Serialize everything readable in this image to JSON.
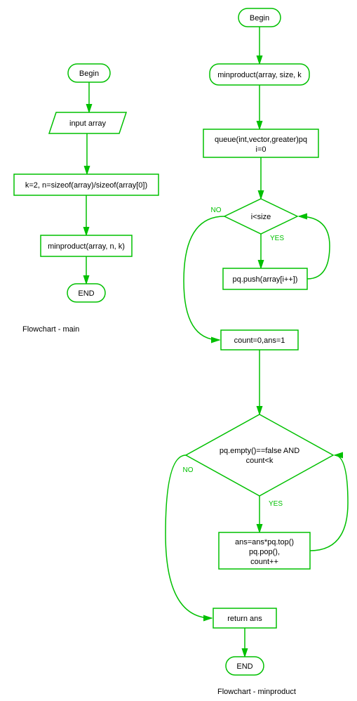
{
  "main": {
    "begin": "Begin",
    "input": "input array",
    "assign": "k=2, n=sizeof(array)/sizeof(array[0])",
    "call": "minproduct(array, n, k)",
    "end": "END",
    "caption": "Flowchart - main"
  },
  "minproduct": {
    "begin": "Begin",
    "call": "minproduct(array, size, k",
    "queue_line1": "queue(int,vector,greater)pq",
    "queue_line2": "i=0",
    "cond1": "i<size",
    "cond1_no": "NO",
    "cond1_yes": "YES",
    "push": "pq.push(array[i++])",
    "assign2": "count=0,ans=1",
    "cond2_line1": "pq.empty()==false AND",
    "cond2_line2": "count<k",
    "cond2_no": "NO",
    "cond2_yes": "YES",
    "body_line1": "ans=ans*pq.top()",
    "body_line2": "pq.pop(),",
    "body_line3": "count++",
    "return": "return ans",
    "end": "END",
    "caption": "Flowchart - minproduct"
  },
  "chart_data": [
    {
      "type": "flowchart",
      "name": "main",
      "nodes": [
        {
          "id": "m1",
          "shape": "terminator",
          "label": "Begin"
        },
        {
          "id": "m2",
          "shape": "parallelogram",
          "label": "input array"
        },
        {
          "id": "m3",
          "shape": "rectangle",
          "label": "k=2, n=sizeof(array)/sizeof(array[0])"
        },
        {
          "id": "m4",
          "shape": "rectangle",
          "label": "minproduct(array, n, k)"
        },
        {
          "id": "m5",
          "shape": "terminator",
          "label": "END"
        }
      ],
      "edges": [
        {
          "from": "m1",
          "to": "m2"
        },
        {
          "from": "m2",
          "to": "m3"
        },
        {
          "from": "m3",
          "to": "m4"
        },
        {
          "from": "m4",
          "to": "m5"
        }
      ]
    },
    {
      "type": "flowchart",
      "name": "minproduct",
      "nodes": [
        {
          "id": "p1",
          "shape": "terminator",
          "label": "Begin"
        },
        {
          "id": "p2",
          "shape": "rectangle",
          "label": "minproduct(array, size, k"
        },
        {
          "id": "p3",
          "shape": "rectangle",
          "label": "queue(int,vector,greater)pq\ni=0"
        },
        {
          "id": "p4",
          "shape": "diamond",
          "label": "i<size"
        },
        {
          "id": "p5",
          "shape": "rectangle",
          "label": "pq.push(array[i++])"
        },
        {
          "id": "p6",
          "shape": "rectangle",
          "label": "count=0,ans=1"
        },
        {
          "id": "p7",
          "shape": "diamond",
          "label": "pq.empty()==false AND\ncount<k"
        },
        {
          "id": "p8",
          "shape": "rectangle",
          "label": "ans=ans*pq.top()\npq.pop(),\ncount++"
        },
        {
          "id": "p9",
          "shape": "rectangle",
          "label": "return ans"
        },
        {
          "id": "p10",
          "shape": "terminator",
          "label": "END"
        }
      ],
      "edges": [
        {
          "from": "p1",
          "to": "p2"
        },
        {
          "from": "p2",
          "to": "p3"
        },
        {
          "from": "p3",
          "to": "p4"
        },
        {
          "from": "p4",
          "to": "p5",
          "label": "YES"
        },
        {
          "from": "p5",
          "to": "p4",
          "loop": true
        },
        {
          "from": "p4",
          "to": "p6",
          "label": "NO"
        },
        {
          "from": "p6",
          "to": "p7"
        },
        {
          "from": "p7",
          "to": "p8",
          "label": "YES"
        },
        {
          "from": "p8",
          "to": "p7",
          "loop": true
        },
        {
          "from": "p7",
          "to": "p9",
          "label": "NO"
        },
        {
          "from": "p9",
          "to": "p10"
        }
      ]
    }
  ]
}
